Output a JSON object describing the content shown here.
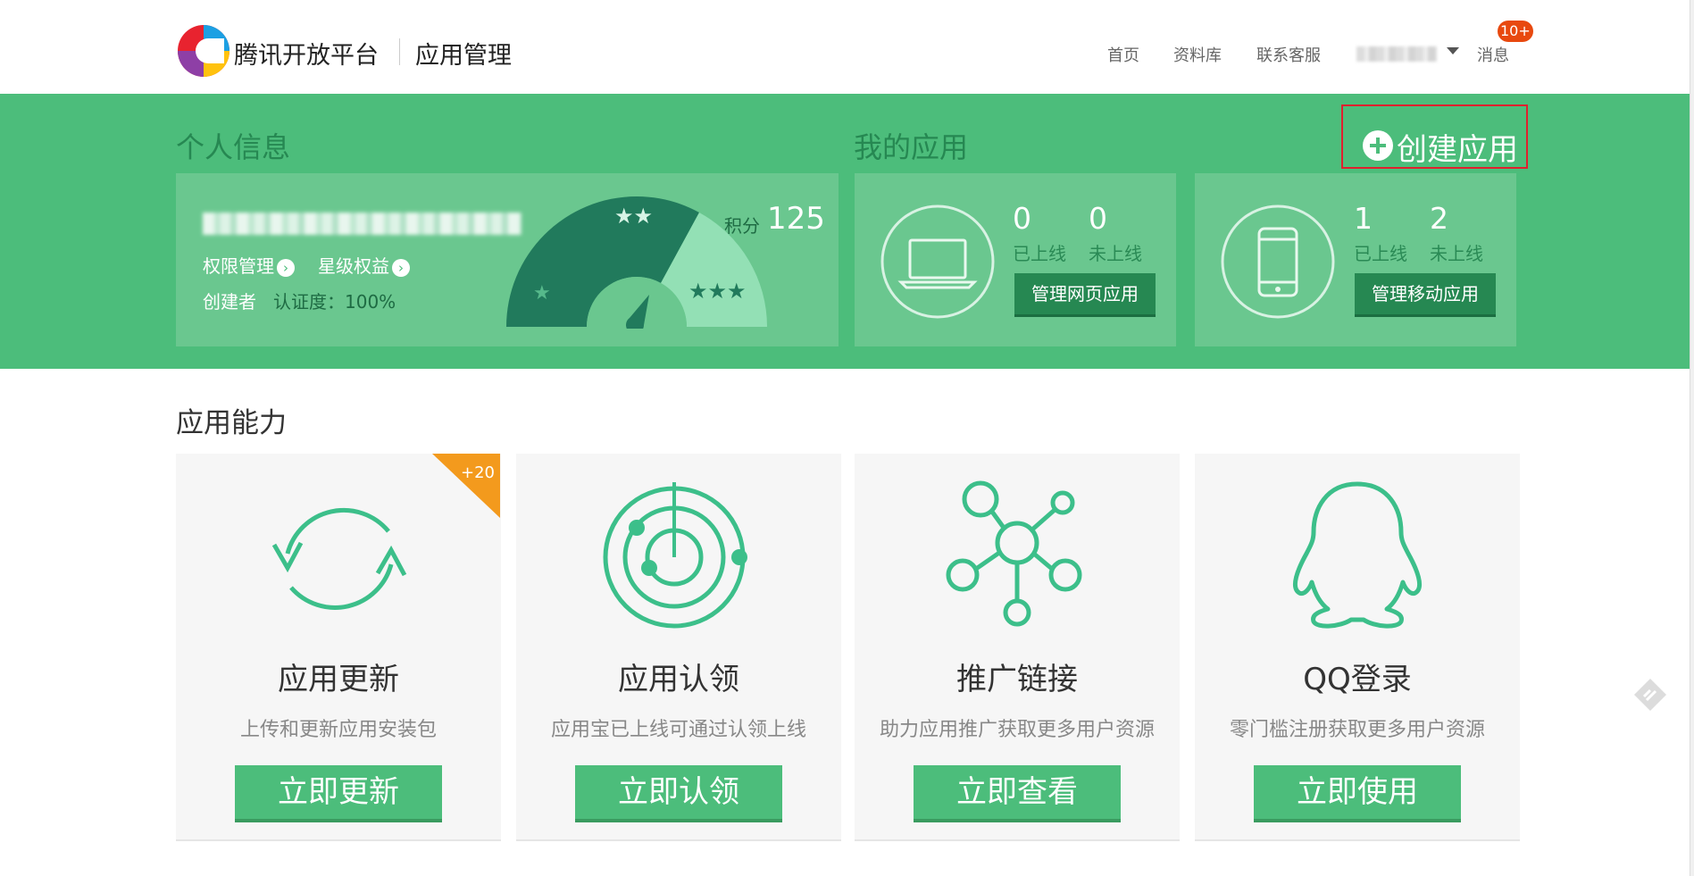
{
  "header": {
    "brand": "腾讯开放平台",
    "section": "应用管理",
    "nav": [
      {
        "label": "首页"
      },
      {
        "label": "资料库"
      },
      {
        "label": "联系客服"
      }
    ],
    "messages_label": "消息",
    "messages_badge": "10+"
  },
  "profile": {
    "title": "个人信息",
    "permissions_link": "权限管理",
    "benefits_link": "星级权益",
    "role": "创建者",
    "certification": "认证度：100%",
    "score_label": "积分",
    "score_value": "125",
    "stars_low": "★",
    "stars_mid": "★★",
    "stars_high": "★★★"
  },
  "my_apps": {
    "title": "我的应用",
    "create_label": "创建应用",
    "web": {
      "online": "0",
      "offline": "0",
      "online_label": "已上线",
      "offline_label": "未上线",
      "manage_label": "管理网页应用"
    },
    "mobile": {
      "online": "1",
      "offline": "2",
      "online_label": "已上线",
      "offline_label": "未上线",
      "manage_label": "管理移动应用"
    }
  },
  "capabilities": {
    "title": "应用能力",
    "cards": [
      {
        "icon": "refresh-icon",
        "title": "应用更新",
        "desc": "上传和更新应用安装包",
        "button": "立即更新",
        "corner": "+20"
      },
      {
        "icon": "radar-icon",
        "title": "应用认领",
        "desc": "应用宝已上线可通过认领上线",
        "button": "立即认领"
      },
      {
        "icon": "network-icon",
        "title": "推广链接",
        "desc": "助力应用推广获取更多用户资源",
        "button": "立即查看"
      },
      {
        "icon": "qq-penguin-icon",
        "title": "QQ登录",
        "desc": "零门槛注册获取更多用户资源",
        "button": "立即使用"
      }
    ]
  },
  "colors": {
    "brand_green": "#4cbd7b",
    "dark_green": "#268852",
    "badge": "#e8490f",
    "corner_orange": "#f39a1d",
    "highlight_red": "#e0202e"
  }
}
